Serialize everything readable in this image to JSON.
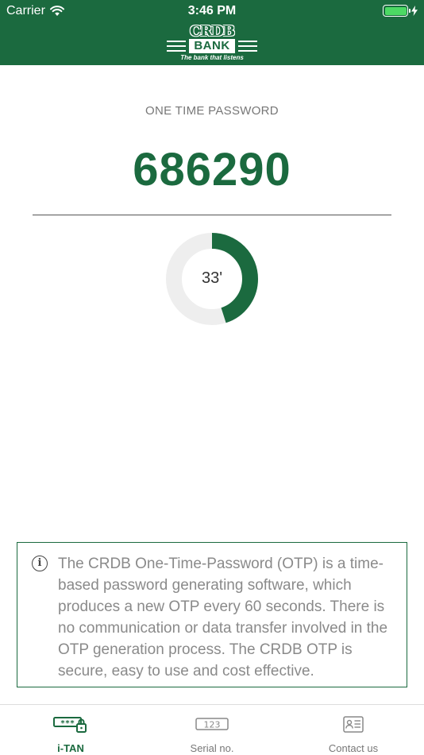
{
  "status_bar": {
    "carrier": "Carrier",
    "time": "3:46 PM",
    "wifi_icon": "wifi-icon",
    "battery_icon": "battery-icon",
    "charging_icon": "charging-bolt-icon"
  },
  "header": {
    "logo_text": "CRDB",
    "logo_bank": "BANK",
    "tagline": "The bank that listens",
    "background_color": "#1b6a3f"
  },
  "otp": {
    "label": "ONE TIME PASSWORD",
    "code": "686290",
    "code_color": "#1b6a3f"
  },
  "timer": {
    "label": "33'",
    "remaining_seconds": 33,
    "period_seconds": 60,
    "progress_color": "#1b6a3f",
    "track_color": "#eeeeee"
  },
  "info": {
    "icon": "info-icon",
    "text": "The CRDB One-Time-Password (OTP) is a time-based password generating software, which produces a new OTP every 60 seconds. There is no communication or data transfer involved in the OTP generation process. The CRDB OTP is secure, easy to use and cost effective."
  },
  "tabs": [
    {
      "label": "i-TAN",
      "icon": "password-lock-icon",
      "active": true
    },
    {
      "label": "Serial no.",
      "icon": "serial-number-icon",
      "active": false
    },
    {
      "label": "Contact us",
      "icon": "contact-card-icon",
      "active": false
    }
  ]
}
